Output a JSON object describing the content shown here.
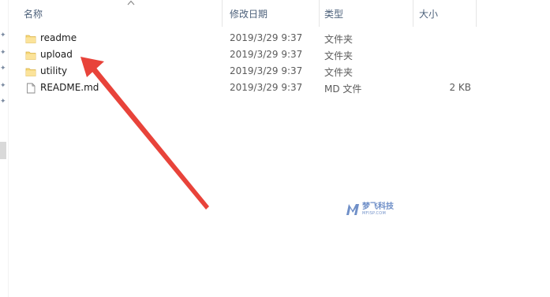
{
  "columns": {
    "name": "名称",
    "date": "修改日期",
    "type": "类型",
    "size": "大小"
  },
  "files": [
    {
      "name": "readme",
      "date": "2019/3/29 9:37",
      "type": "文件夹",
      "size": "",
      "icon": "folder-icon"
    },
    {
      "name": "upload",
      "date": "2019/3/29 9:37",
      "type": "文件夹",
      "size": "",
      "icon": "folder-icon"
    },
    {
      "name": "utility",
      "date": "2019/3/29 9:37",
      "type": "文件夹",
      "size": "",
      "icon": "folder-icon"
    },
    {
      "name": "README.md",
      "date": "2019/3/29 9:37",
      "type": "MD 文件",
      "size": "2 KB",
      "icon": "file-icon"
    }
  ],
  "colors": {
    "header_text": "#4c607a",
    "folder": "#f6d775",
    "arrow": "#e8433a",
    "watermark": "#6f8fc8"
  },
  "watermark": {
    "logo": "MF",
    "title": "梦飞科技",
    "subtitle": "MFISP.COM"
  }
}
